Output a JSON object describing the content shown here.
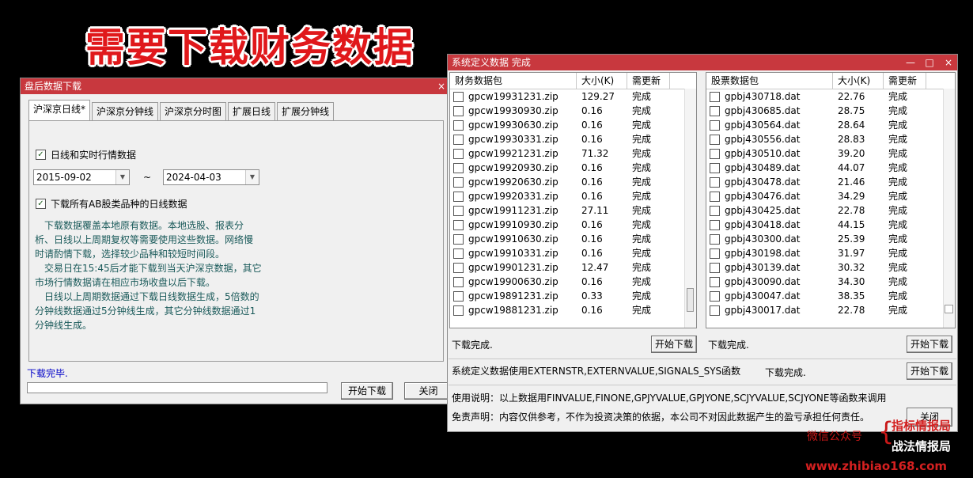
{
  "banner": "需要下载财务数据",
  "left_window": {
    "title": "盘后数据下载",
    "close_glyph": "×",
    "tabs": [
      "沪深京日线*",
      "沪深京分钟线",
      "沪深京分时图",
      "扩展日线",
      "扩展分钟线"
    ],
    "chk_daily": {
      "label": "日线和实时行情数据",
      "checked": true
    },
    "date_start": "2015-09-02",
    "date_tilde": "~",
    "date_end": "2024-04-03",
    "chk_ab": {
      "label": "下载所有AB股类品种的日线数据",
      "checked": true
    },
    "note_lines": [
      "　下载数据覆盖本地原有数据。本地选股、报表分",
      "析、日线以上周期复权等需要使用这些数据。网络慢",
      "时请酌情下载，选择较少品种和较短时间段。",
      "　交易日在15:45后才能下载到当天沪深京数据，其它",
      "市场行情数据请在相应市场收盘以后下载。",
      "　日线以上周期数据通过下载日线数据生成，5倍数的",
      "分钟线数据通过5分钟线生成，其它分钟线数据通过1",
      "分钟线生成。"
    ],
    "status": "下载完毕.",
    "progress": 0,
    "start_button": "开始下载",
    "close_button": "关闭"
  },
  "right_window": {
    "title": "系统定义数据 完成",
    "title_buttons": [
      "—",
      "□",
      "×"
    ],
    "fin_list": {
      "headers": [
        "财务数据包",
        "大小(K)",
        "需更新"
      ],
      "rows": [
        [
          "gpcw19931231.zip",
          "129.27",
          "完成"
        ],
        [
          "gpcw19930930.zip",
          "0.16",
          "完成"
        ],
        [
          "gpcw19930630.zip",
          "0.16",
          "完成"
        ],
        [
          "gpcw19930331.zip",
          "0.16",
          "完成"
        ],
        [
          "gpcw19921231.zip",
          "71.32",
          "完成"
        ],
        [
          "gpcw19920930.zip",
          "0.16",
          "完成"
        ],
        [
          "gpcw19920630.zip",
          "0.16",
          "完成"
        ],
        [
          "gpcw19920331.zip",
          "0.16",
          "完成"
        ],
        [
          "gpcw19911231.zip",
          "27.11",
          "完成"
        ],
        [
          "gpcw19910930.zip",
          "0.16",
          "完成"
        ],
        [
          "gpcw19910630.zip",
          "0.16",
          "完成"
        ],
        [
          "gpcw19910331.zip",
          "0.16",
          "完成"
        ],
        [
          "gpcw19901231.zip",
          "12.47",
          "完成"
        ],
        [
          "gpcw19900630.zip",
          "0.16",
          "完成"
        ],
        [
          "gpcw19891231.zip",
          "0.33",
          "完成"
        ],
        [
          "gpcw19881231.zip",
          "0.16",
          "完成"
        ]
      ],
      "status": "下载完成.",
      "button": "开始下载"
    },
    "stock_list": {
      "headers": [
        "股票数据包",
        "大小(K)",
        "需更新"
      ],
      "rows": [
        [
          "gpbj430718.dat",
          "22.76",
          "完成"
        ],
        [
          "gpbj430685.dat",
          "28.75",
          "完成"
        ],
        [
          "gpbj430564.dat",
          "28.64",
          "完成"
        ],
        [
          "gpbj430556.dat",
          "28.83",
          "完成"
        ],
        [
          "gpbj430510.dat",
          "39.20",
          "完成"
        ],
        [
          "gpbj430489.dat",
          "44.07",
          "完成"
        ],
        [
          "gpbj430478.dat",
          "21.46",
          "完成"
        ],
        [
          "gpbj430476.dat",
          "34.29",
          "完成"
        ],
        [
          "gpbj430425.dat",
          "22.78",
          "完成"
        ],
        [
          "gpbj430418.dat",
          "44.15",
          "完成"
        ],
        [
          "gpbj430300.dat",
          "25.39",
          "完成"
        ],
        [
          "gpbj430198.dat",
          "31.97",
          "完成"
        ],
        [
          "gpbj430139.dat",
          "30.32",
          "完成"
        ],
        [
          "gpbj430090.dat",
          "34.30",
          "完成"
        ],
        [
          "gpbj430047.dat",
          "38.35",
          "完成"
        ],
        [
          "gpbj430017.dat",
          "22.78",
          "完成"
        ]
      ],
      "status": "下载完成.",
      "button": "开始下载"
    },
    "sys_row": {
      "label": "系统定义数据使用EXTERNSTR,EXTERNVALUE,SIGNALS_SYS函数",
      "status": "下载完成.",
      "button": "开始下载"
    },
    "usage": "使用说明：以上数据用FINVALUE,FINONE,GPJYVALUE,GPJYONE,SCJYVALUE,SCJYONE等函数来调用",
    "disclaimer": "免责声明：内容仅供参考，不作为投资决策的依据，本公司不对因此数据产生的盈亏承担任何责任。",
    "close_button": "关闭"
  },
  "watermark": {
    "label": "微信公众号",
    "brace": "{",
    "name1": "指标情报局",
    "name2": "战法情报局",
    "url": "www.zhibiao168.com"
  }
}
